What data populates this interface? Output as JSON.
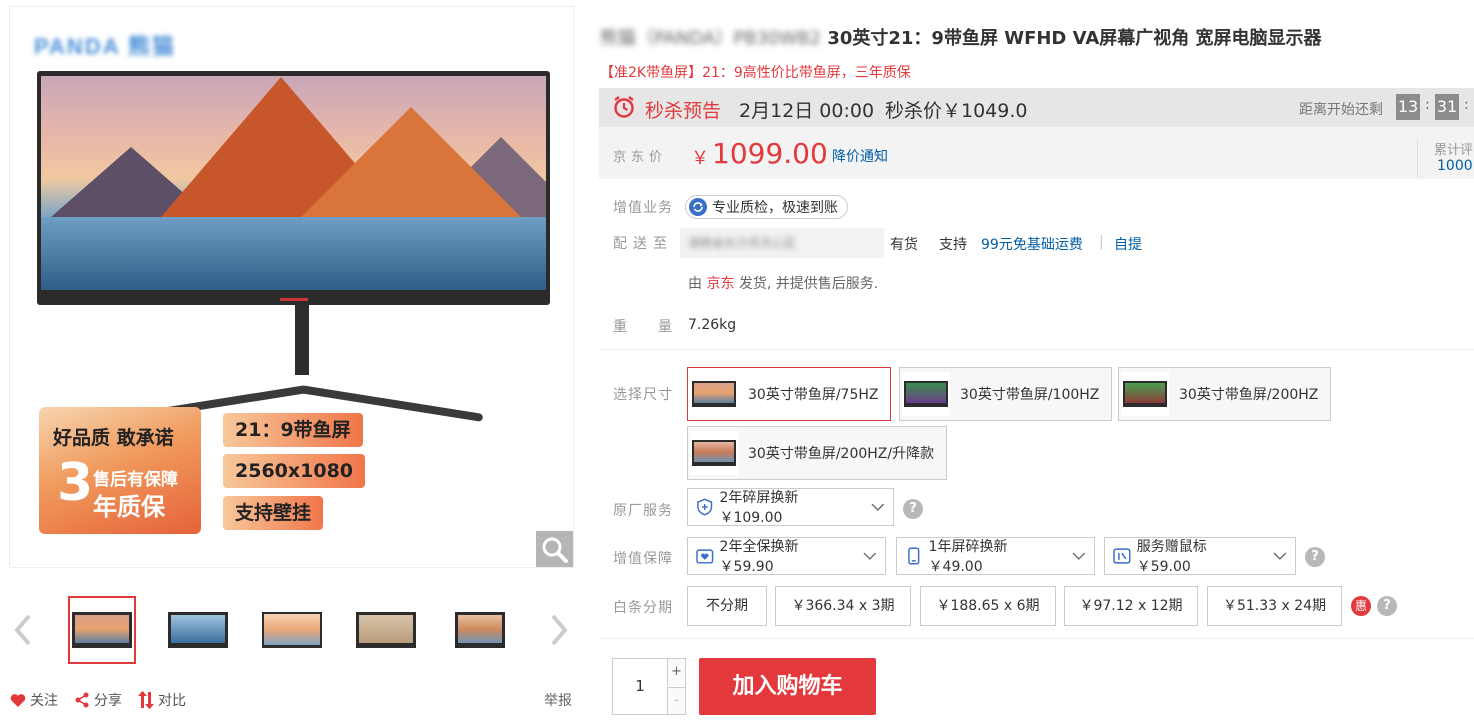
{
  "gallery": {
    "brand_logo": "PANDA 熊猫",
    "promo": {
      "quality": "好品质 敢承诺",
      "big_number": "3",
      "after_sale": "售后有保障",
      "warranty": "年质保"
    },
    "tags": [
      "21：9带鱼屏",
      "2560x1080",
      "支持壁挂"
    ]
  },
  "actions": {
    "follow": "关注",
    "share": "分享",
    "compare": "对比",
    "report": "举报"
  },
  "product": {
    "title_blurred": "熊猫（PANDA）PB30WB2",
    "title": "30英寸21：9带鱼屏 WFHD VA屏幕广视角 宽屏电脑显示器",
    "subtitle": "【准2K带鱼屏】21：9高性价比带鱼屏，三年质保"
  },
  "seckill": {
    "label": "秒杀预告",
    "time": "2月12日 00:00",
    "price": "秒杀价￥1049.0",
    "countdown_label": "距离开始还剩",
    "hours": "13",
    "minutes": "31"
  },
  "price": {
    "label": "京东价",
    "currency": "￥",
    "value": "1099.00",
    "notify": "降价通知",
    "review_label": "累计评",
    "review_count": "1000"
  },
  "service": {
    "label": "增值业务",
    "pill": "专业质检，极速到账"
  },
  "delivery": {
    "label": "配送至",
    "address_blurred": "湖南省长沙市天心区",
    "stock": "有货",
    "support": "支持",
    "shipping": "99元免基础运费",
    "separator": "|",
    "pickup": "自提",
    "seller_prefix": "由",
    "seller": "京东",
    "seller_suffix": "发货, 并提供售后服务."
  },
  "weight": {
    "label": "重　　量",
    "value": "7.26kg"
  },
  "size": {
    "label": "选择尺寸",
    "options": [
      "30英寸带鱼屏/75HZ",
      "30英寸带鱼屏/100HZ",
      "30英寸带鱼屏/200HZ",
      "30英寸带鱼屏/200HZ/升降款"
    ]
  },
  "factory_service": {
    "label": "原厂服务",
    "option": "2年碎屏换新 ￥109.00"
  },
  "protection": {
    "label": "增值保障",
    "options": [
      "2年全保换新 ￥59.90",
      "1年屏碎换新 ￥49.00",
      "服务赠鼠标 ￥59.00"
    ]
  },
  "installments": {
    "label": "白条分期",
    "options": [
      "不分期",
      "￥366.34 x 3期",
      "￥188.65 x 6期",
      "￥97.12 x 12期",
      "￥51.33 x 24期"
    ],
    "hui": "惠"
  },
  "cart": {
    "quantity": "1",
    "plus": "+",
    "minus": "-",
    "button": "加入购物车"
  },
  "colors": {
    "accent": "#e4393c",
    "link": "#005ea7"
  }
}
